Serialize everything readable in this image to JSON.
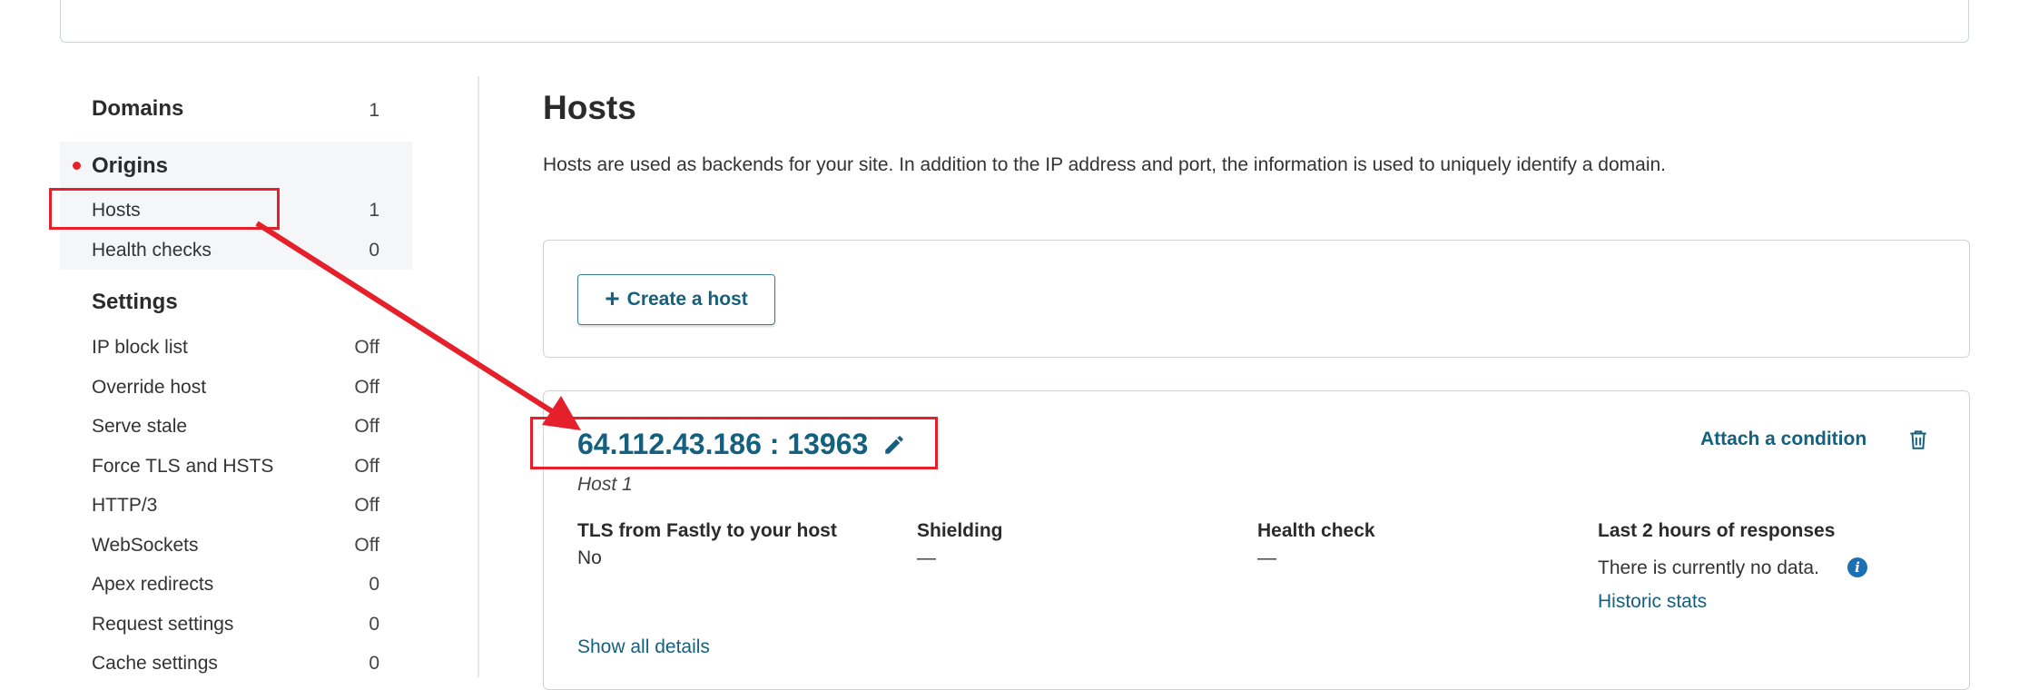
{
  "sidebar": {
    "domains": {
      "label": "Domains",
      "count": "1"
    },
    "origins": {
      "label": "Origins"
    },
    "origin_items": [
      {
        "label": "Hosts",
        "value": "1"
      },
      {
        "label": "Health checks",
        "value": "0"
      }
    ],
    "settings": {
      "label": "Settings"
    },
    "settings_items": [
      {
        "label": "IP block list",
        "value": "Off"
      },
      {
        "label": "Override host",
        "value": "Off"
      },
      {
        "label": "Serve stale",
        "value": "Off"
      },
      {
        "label": "Force TLS and HSTS",
        "value": "Off"
      },
      {
        "label": "HTTP/3",
        "value": "Off"
      },
      {
        "label": "WebSockets",
        "value": "Off"
      },
      {
        "label": "Apex redirects",
        "value": "0"
      },
      {
        "label": "Request settings",
        "value": "0"
      },
      {
        "label": "Cache settings",
        "value": "0"
      }
    ]
  },
  "main": {
    "title": "Hosts",
    "description": "Hosts are used as backends for your site. In addition to the IP address and port, the information is used to uniquely identify a domain.",
    "create_button": "Create a host",
    "host": {
      "address": "64.112.43.186 : 13963",
      "name": "Host 1",
      "attach_condition": "Attach a condition",
      "columns": [
        {
          "header": "TLS from Fastly to your host",
          "value": "No"
        },
        {
          "header": "Shielding",
          "value": "—"
        },
        {
          "header": "Health check",
          "value": "—"
        },
        {
          "header": "Last 2 hours of responses",
          "value": "There is currently no data."
        }
      ],
      "historic_stats": "Historic stats",
      "show_details": "Show all details"
    }
  },
  "colors": {
    "accent": "#14607e",
    "annotation": "#e5202b",
    "info": "#1a6fb5"
  },
  "icons": [
    "pencil-icon",
    "trash-icon",
    "info-icon",
    "plus-icon"
  ]
}
